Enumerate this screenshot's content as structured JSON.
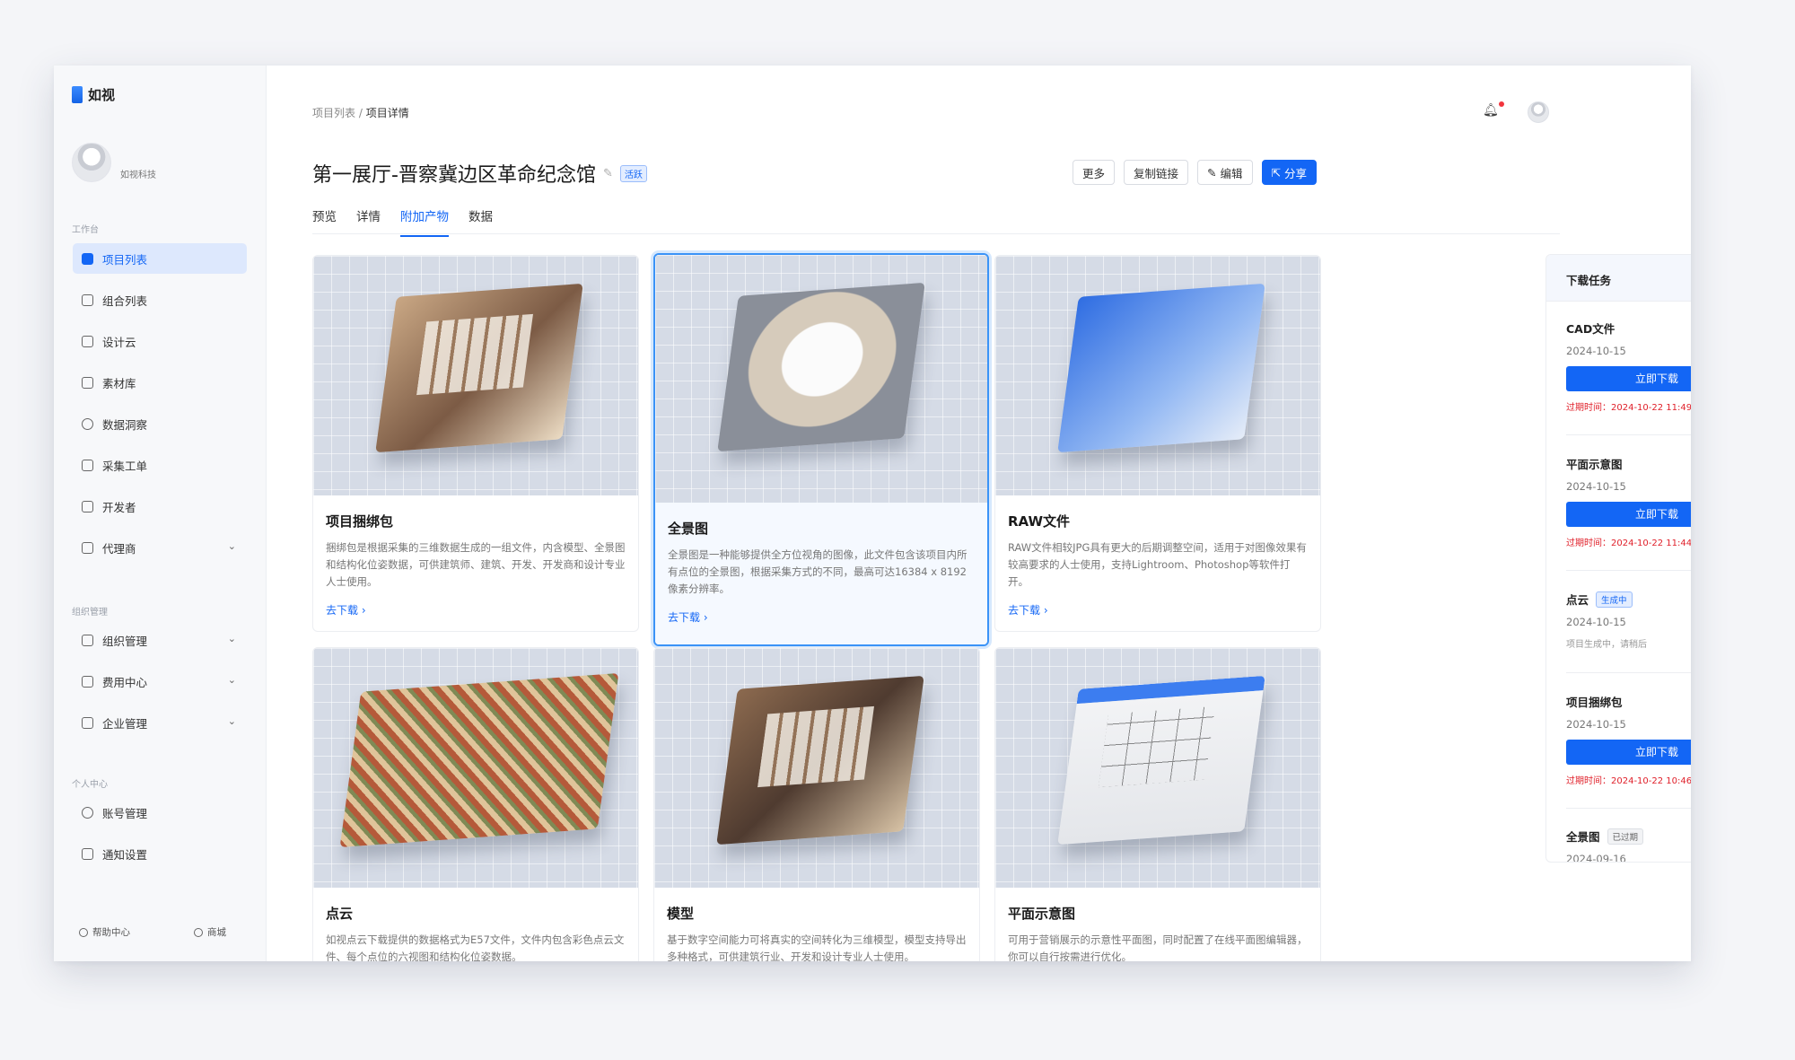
{
  "app": {
    "name": "如视",
    "org": "如视科技"
  },
  "sidebar": {
    "sections": {
      "workspace": "工作台",
      "org": "组织管理",
      "personal": "个人中心"
    },
    "items": [
      {
        "label": "项目列表"
      },
      {
        "label": "组合列表"
      },
      {
        "label": "设计云"
      },
      {
        "label": "素材库"
      },
      {
        "label": "数据洞察"
      },
      {
        "label": "采集工单"
      },
      {
        "label": "开发者"
      },
      {
        "label": "代理商"
      },
      {
        "label": "组织管理"
      },
      {
        "label": "费用中心"
      },
      {
        "label": "企业管理"
      },
      {
        "label": "账号管理"
      },
      {
        "label": "通知设置"
      }
    ],
    "footer": {
      "help": "帮助中心",
      "store": "商城"
    }
  },
  "breadcrumb": {
    "parent": "项目列表",
    "current": "项目详情"
  },
  "project": {
    "title": "第一展厅-晋察冀边区革命纪念馆",
    "status": "活跃"
  },
  "actions": {
    "more": "更多",
    "copy_link": "复制链接",
    "edit": "编辑",
    "share": "分享"
  },
  "tabs": [
    "预览",
    "详情",
    "附加产物",
    "数据"
  ],
  "cards": [
    {
      "title": "项目捆绑包",
      "desc": "捆绑包是根据采集的三维数据生成的一组文件，内含模型、全景图和结构化位姿数据，可供建筑师、建筑、开发、开发商和设计专业人士使用。",
      "link": "去下载 ›"
    },
    {
      "title": "全景图",
      "desc": "全景图是一种能够提供全方位视角的图像，此文件包含该项目内所有点位的全景图，根据采集方式的不同，最高可达16384 x 8192 像素分辨率。",
      "link": "去下载 ›"
    },
    {
      "title": "RAW文件",
      "desc": "RAW文件相较JPG具有更大的后期调整空间，适用于对图像效果有较高要求的人士使用，支持Lightroom、Photoshop等软件打开。",
      "link": "去下载 ›"
    },
    {
      "title": "点云",
      "desc": "如视点云下载提供的数据格式为E57文件，文件内包含彩色点云文件、每个点位的六视图和结构化位姿数据。",
      "link": ""
    },
    {
      "title": "模型",
      "desc": "基于数字空间能力可将真实的空间转化为三维模型，模型支持导出多种格式，可供建筑行业、开发和设计专业人士使用。",
      "link": ""
    },
    {
      "title": "平面示意图",
      "desc": "可用于营销展示的示意性平面图，同时配置了在线平面图编辑器，你可以自行按需进行优化。",
      "link": ""
    }
  ],
  "tasks": {
    "title": "下载任务",
    "items": [
      {
        "name": "CAD文件",
        "date": "2024-10-15",
        "button": "立即下载",
        "expire": "过期时间：2024-10-22 11:49"
      },
      {
        "name": "平面示意图",
        "date": "2024-10-15",
        "button": "立即下载",
        "expire": "过期时间：2024-10-22 11:44"
      },
      {
        "name": "点云",
        "badge": "生成中",
        "date": "2024-10-15",
        "note": "项目生成中，请稍后"
      },
      {
        "name": "项目捆绑包",
        "date": "2024-10-15",
        "button": "立即下载",
        "expire": "过期时间：2024-10-22 10:46"
      },
      {
        "name": "全景图",
        "badge": "已过期",
        "date": "2024-09-16"
      }
    ]
  },
  "colors": {
    "accent": "#1366f5",
    "expire": "#e0202a",
    "active_bg": "#dde8fd"
  }
}
